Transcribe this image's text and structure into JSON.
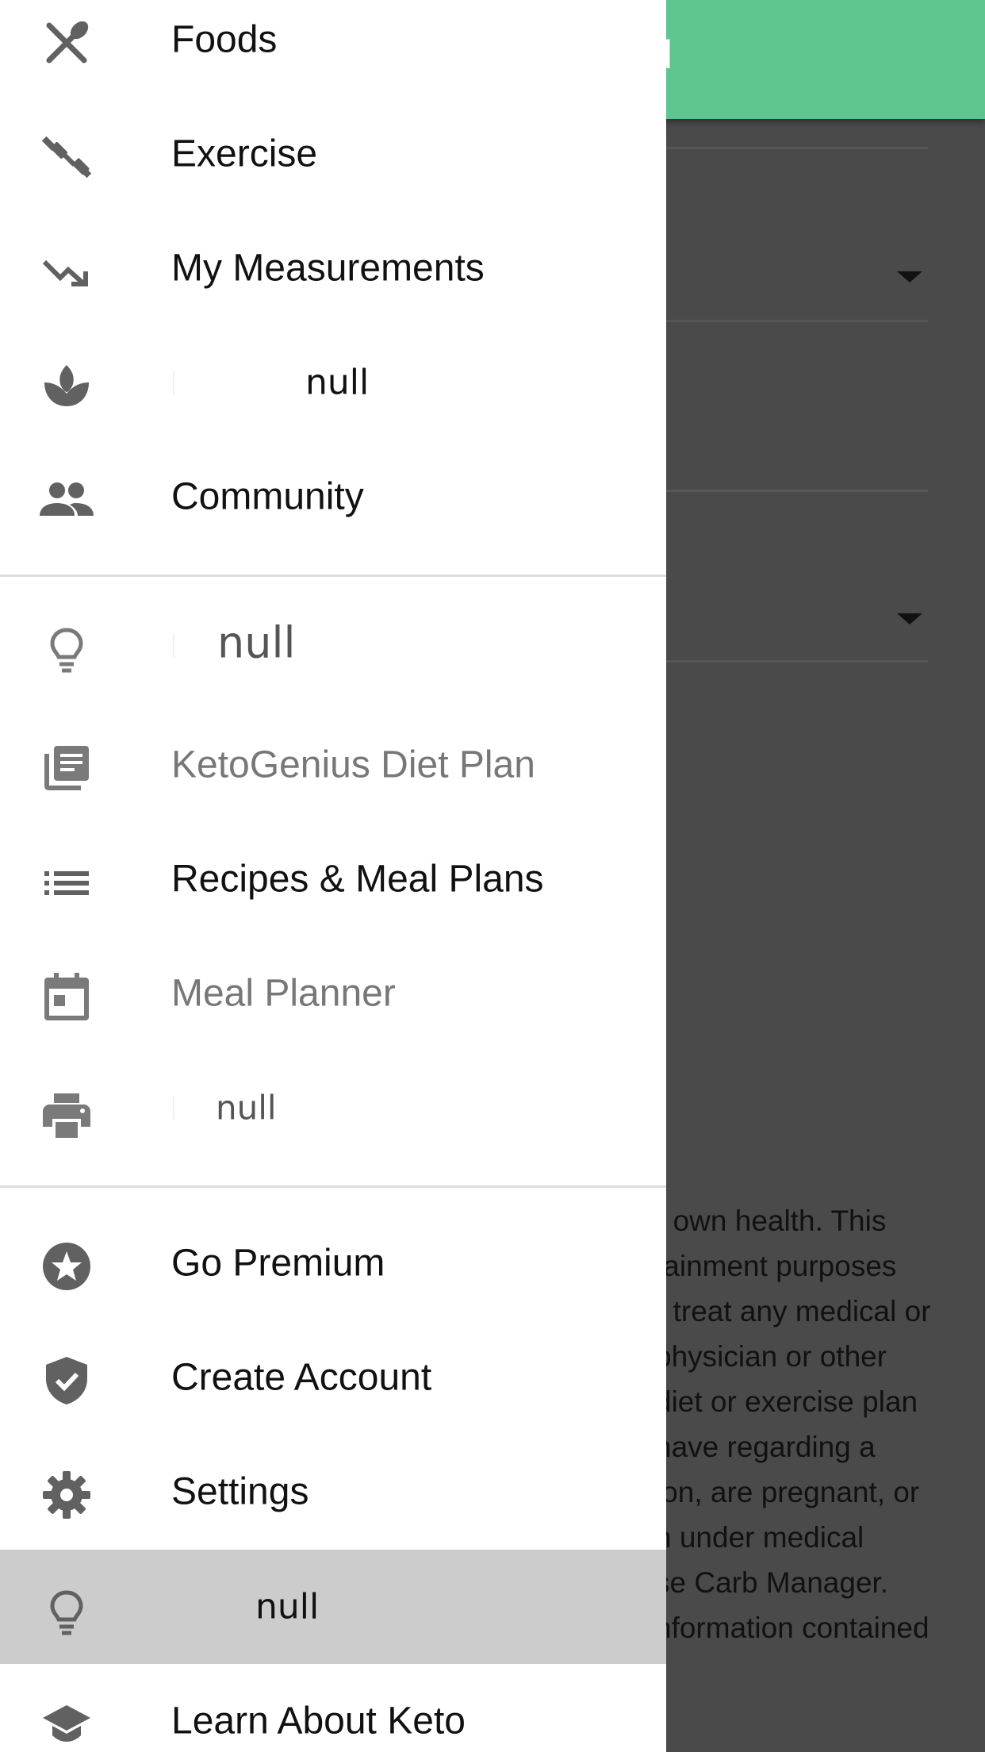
{
  "background": {
    "header_title": "d",
    "disclaimer_lines": [
      "r own health. This",
      "tainment purposes",
      "r treat any medical or",
      "physician or other",
      "diet or exercise plan",
      "have regarding a",
      "ion, are pregnant, or",
      "n under medical",
      "se Carb Manager.",
      "nformation contained"
    ]
  },
  "drawer": {
    "items": [
      {
        "label": "Foods",
        "icon": "utensils-icon"
      },
      {
        "label": "Exercise",
        "icon": "dumbbell-icon"
      },
      {
        "label": "My Measurements",
        "icon": "trending-down-icon"
      },
      {
        "label": "null",
        "icon": "spa-leaf-icon"
      },
      {
        "label": "Community",
        "icon": "people-icon"
      },
      {
        "label": "null",
        "icon": "lightbulb-icon"
      },
      {
        "label": "KetoGenius Diet Plan",
        "icon": "library-books-icon"
      },
      {
        "label": "Recipes & Meal Plans",
        "icon": "list-icon"
      },
      {
        "label": "Meal Planner",
        "icon": "calendar-icon"
      },
      {
        "label": "null",
        "icon": "print-icon"
      },
      {
        "label": "Go Premium",
        "icon": "star-circle-icon"
      },
      {
        "label": "Create Account",
        "icon": "verified-shield-icon"
      },
      {
        "label": "Settings",
        "icon": "gear-icon"
      },
      {
        "label": "null",
        "icon": "lightbulb-icon"
      },
      {
        "label": "Learn About Keto",
        "icon": "school-cap-icon"
      }
    ]
  },
  "colors": {
    "header_green": "#5ec590",
    "scrim": "#4a4a4a",
    "icon_gray": "#616161",
    "selected_bg": "#cccccc"
  }
}
